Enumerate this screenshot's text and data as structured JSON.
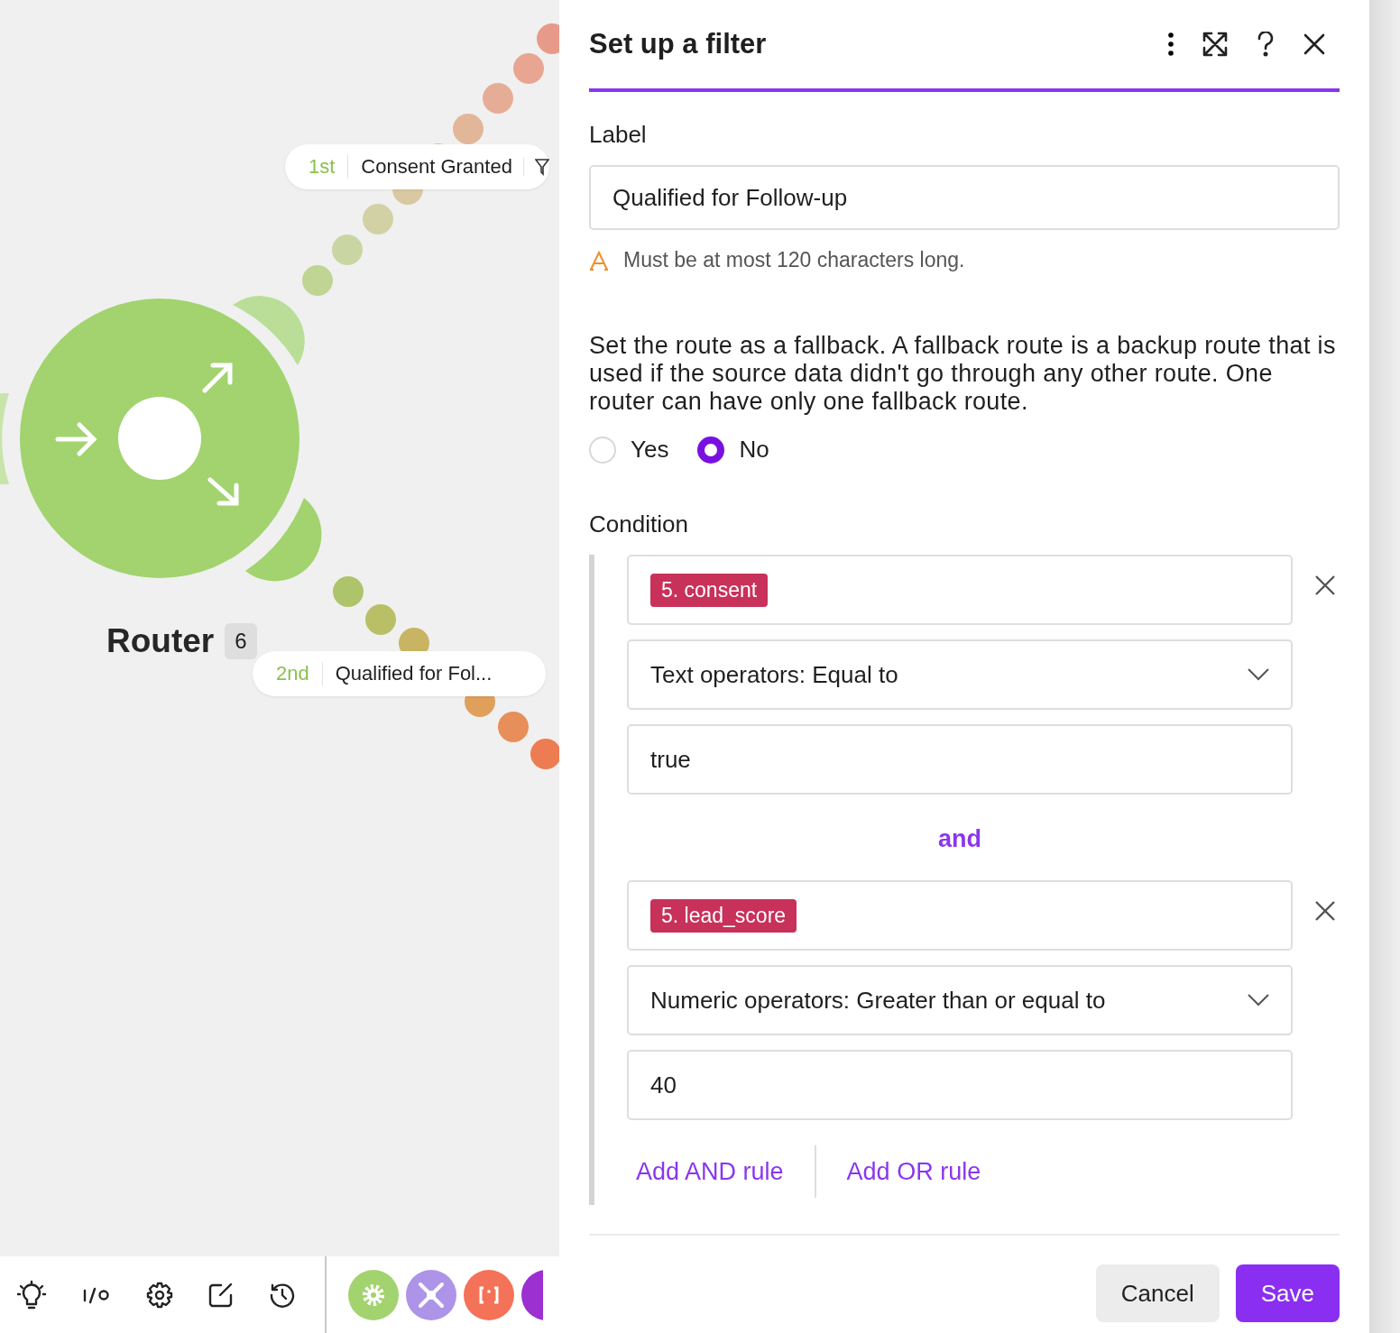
{
  "canvas": {
    "router": {
      "title": "Router",
      "badge": "6"
    },
    "routes": [
      {
        "order": "1st",
        "label": "Consent Granted",
        "kind": "top"
      },
      {
        "order": "2nd",
        "label": "Qualified for Fol...",
        "kind": "bottom"
      }
    ]
  },
  "panel": {
    "title": "Set up a filter",
    "label_field": {
      "label": "Label",
      "value": "Qualified for Follow-up",
      "hint": "Must be at most 120 characters long."
    },
    "fallback": {
      "description": "Set the route as a fallback. A fallback route is a backup route that is used if the source data didn't go through any other route. One router can have only one fallback route.",
      "options": [
        {
          "label": "Yes",
          "selected": false
        },
        {
          "label": "No",
          "selected": true
        }
      ]
    },
    "condition": {
      "label": "Condition",
      "rules": [
        {
          "operand": "5. consent",
          "operator": "Text operators: Equal to",
          "value": "true"
        },
        {
          "connector": "and",
          "operand": "5. lead_score",
          "operator": "Numeric operators: Greater than or equal to",
          "value": "40"
        }
      ],
      "actions": [
        "Add AND rule",
        "Add OR rule"
      ]
    },
    "buttons": [
      {
        "label": "Cancel",
        "kind": "secondary"
      },
      {
        "label": "Save",
        "kind": "primary"
      }
    ]
  }
}
